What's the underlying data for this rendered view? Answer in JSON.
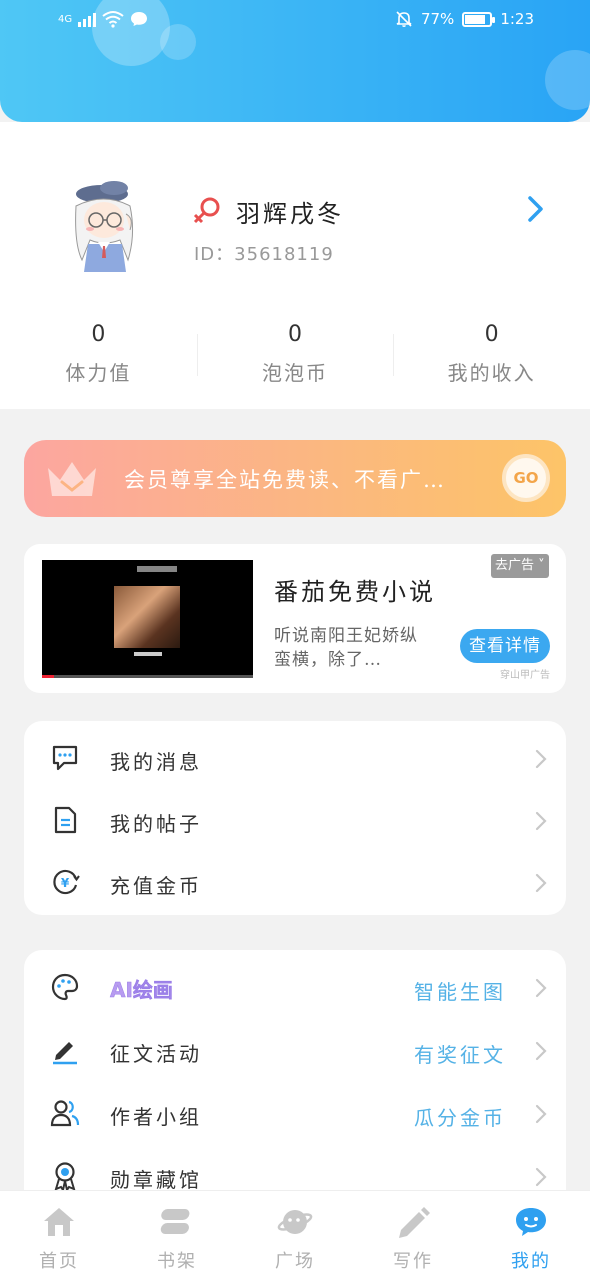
{
  "status_bar": {
    "network": "4G",
    "battery": "77%",
    "time": "1:23",
    "colors": {
      "text": "#ffffff"
    }
  },
  "profile": {
    "username": "羽辉戌冬",
    "id_label": "ID：35618119",
    "gender_icon": "female-icon",
    "stats": [
      {
        "value": "0",
        "label": "体力值"
      },
      {
        "value": "0",
        "label": "泡泡币"
      },
      {
        "value": "0",
        "label": "我的收入"
      }
    ]
  },
  "vip_banner": {
    "text": "会员尊享全站免费读、不看广…",
    "go_label": "GO"
  },
  "ad": {
    "title": "番茄免费小说",
    "description": "听说南阳王妃娇纵蛮横，除了…",
    "close_label": "去广告 ˅",
    "cta_label": "查看详情",
    "source": "穿山甲广告"
  },
  "menu_primary": [
    {
      "icon": "message-icon",
      "label": "我的消息"
    },
    {
      "icon": "post-icon",
      "label": "我的帖子"
    },
    {
      "icon": "coin-recharge-icon",
      "label": "充值金币"
    }
  ],
  "menu_secondary": [
    {
      "icon": "palette-icon",
      "label": "AI绘画",
      "extra": "智能生图"
    },
    {
      "icon": "pen-icon",
      "label": "征文活动",
      "extra": "有奖征文"
    },
    {
      "icon": "group-icon",
      "label": "作者小组",
      "extra": "瓜分金币"
    },
    {
      "icon": "medal-icon",
      "label": "勋章藏馆",
      "extra": ""
    }
  ],
  "tabbar": [
    {
      "icon": "home-icon",
      "label": "首页",
      "active": false
    },
    {
      "icon": "bookshelf-icon",
      "label": "书架",
      "active": false
    },
    {
      "icon": "planet-icon",
      "label": "广场",
      "active": false
    },
    {
      "icon": "write-icon",
      "label": "写作",
      "active": false
    },
    {
      "icon": "me-icon",
      "label": "我的",
      "active": true
    }
  ],
  "colors": {
    "accent": "#2fa0f0",
    "header_gradient": [
      "#4fc7f5",
      "#29a4f5"
    ],
    "vip_gradient": [
      "#fca6a0",
      "#fdc468"
    ],
    "extra_text": "#55b2e6"
  }
}
